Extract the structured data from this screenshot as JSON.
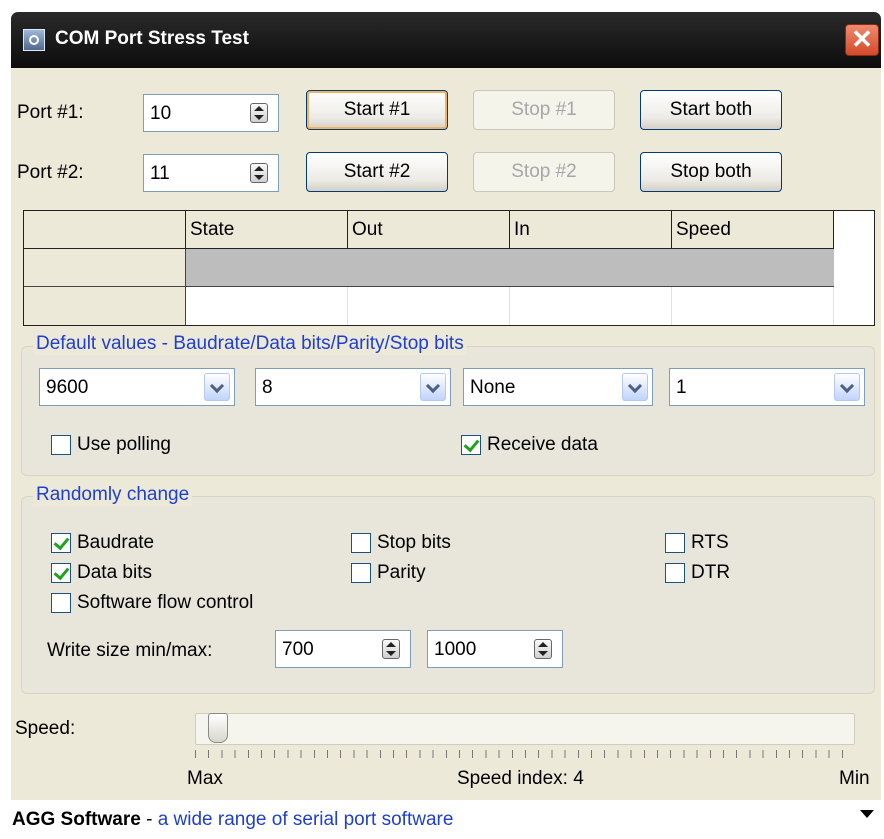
{
  "window": {
    "title": "COM Port Stress Test",
    "close_symbol": "✕"
  },
  "ports": [
    {
      "label": "Port #1:",
      "value": "10",
      "start_label": "Start #1",
      "stop_label": "Stop #1"
    },
    {
      "label": "Port #2:",
      "value": "11",
      "start_label": "Start #2",
      "stop_label": "Stop #2"
    }
  ],
  "buttons": {
    "start_both": "Start both",
    "stop_both": "Stop both"
  },
  "grid": {
    "headers": [
      "",
      "State",
      "Out",
      "In",
      "Speed"
    ]
  },
  "defaults": {
    "title": "Default values - Baudrate/Data bits/Parity/Stop bits",
    "baudrate": "9600",
    "data_bits": "8",
    "parity": "None",
    "stop_bits": "1",
    "use_polling": {
      "label": "Use polling",
      "checked": false
    },
    "receive_data": {
      "label": "Receive data",
      "checked": true
    }
  },
  "random": {
    "title": "Randomly change",
    "baudrate": {
      "label": "Baudrate",
      "checked": true
    },
    "data_bits": {
      "label": "Data bits",
      "checked": true
    },
    "software_flow": {
      "label": "Software flow control",
      "checked": false
    },
    "stop_bits": {
      "label": "Stop bits",
      "checked": false
    },
    "parity": {
      "label": "Parity",
      "checked": false
    },
    "rts": {
      "label": "RTS",
      "checked": false
    },
    "dtr": {
      "label": "DTR",
      "checked": false
    },
    "write_size_label": "Write size min/max:",
    "write_min": "700",
    "write_max": "1000"
  },
  "speed": {
    "label": "Speed:",
    "max_label": "Max",
    "min_label": "Min",
    "index_text": "Speed index: 4",
    "index": 4
  },
  "footer": {
    "brand": "AGG Software",
    "separator": " - ",
    "link": "a wide range of serial port software"
  },
  "colors": {
    "group_title": "#1f3fce",
    "titlebar": "#111111",
    "close": "#d34a2a"
  }
}
